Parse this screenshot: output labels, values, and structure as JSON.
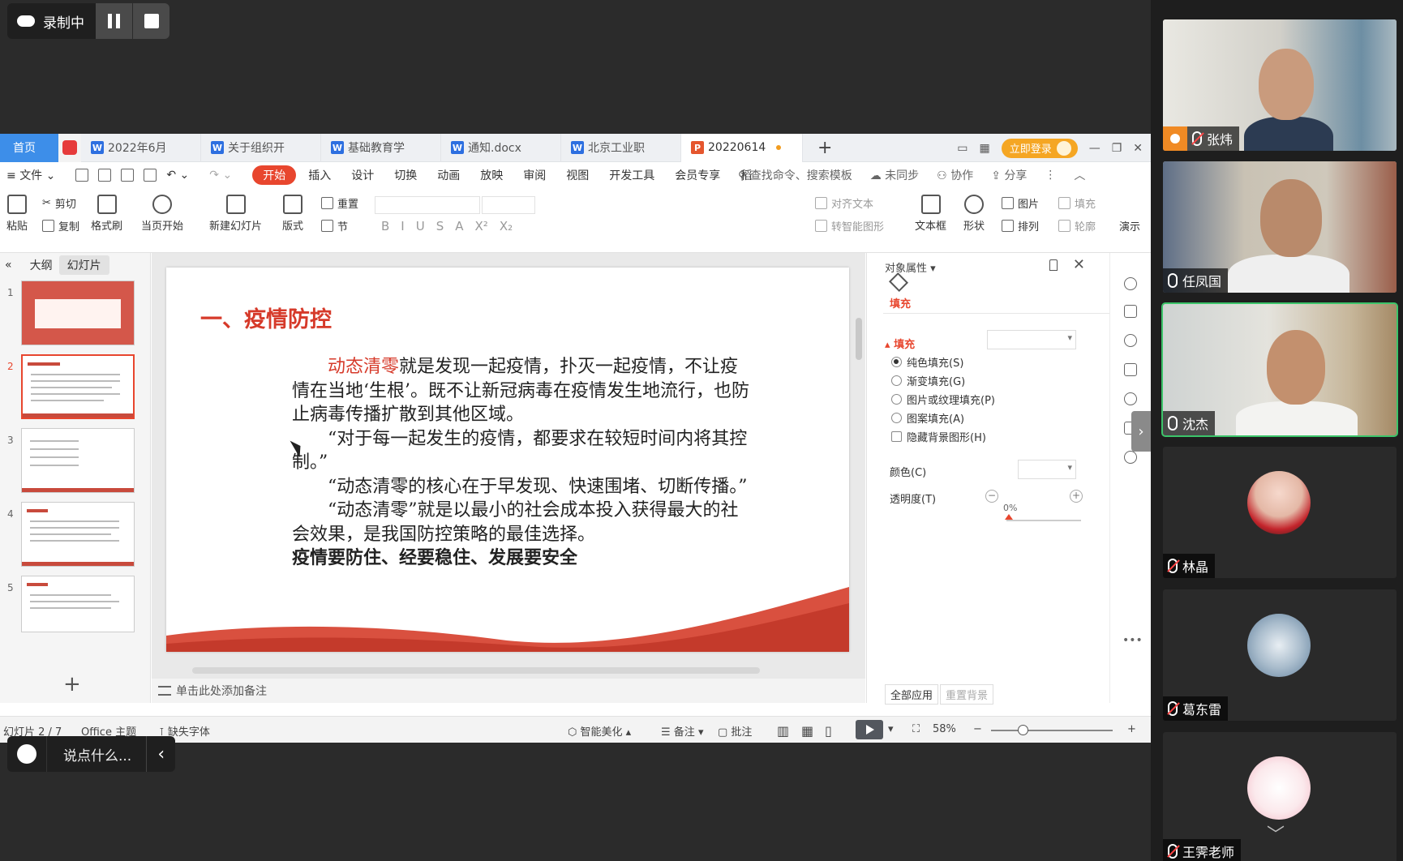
{
  "recording": {
    "label": "录制中"
  },
  "tabs": {
    "home": "首页",
    "docs": [
      {
        "label": "2022年6月",
        "type": "W"
      },
      {
        "label": "关于组织开",
        "type": "W"
      },
      {
        "label": "基础教育学",
        "type": "W"
      },
      {
        "label": "通知.docx",
        "type": "W"
      },
      {
        "label": "北京工业职",
        "type": "W"
      },
      {
        "label": "20220614",
        "type": "P"
      }
    ],
    "login": "立即登录"
  },
  "menu": {
    "file": "文件",
    "items": [
      "开始",
      "插入",
      "设计",
      "切换",
      "动画",
      "放映",
      "审阅",
      "视图",
      "开发工具",
      "会员专享",
      "稻"
    ],
    "search_placeholder": "查找命令、搜索模板",
    "sync": "未同步",
    "collab": "协作",
    "share": "分享"
  },
  "ribbon": {
    "paste": "粘贴",
    "cut": "剪切",
    "copy": "复制",
    "format_painter": "格式刷",
    "from_current": "当页开始",
    "new_slide": "新建幻灯片",
    "layout": "版式",
    "reset": "重置",
    "section": "节",
    "align_text": "对齐文本",
    "convert_smartart": "转智能图形",
    "textbox": "文本框",
    "shape": "形状",
    "picture": "图片",
    "arrange": "排列",
    "fill": "填充",
    "outline": "轮廓",
    "present": "演示"
  },
  "left_panel": {
    "tab_outline": "大纲",
    "tab_slides": "幻灯片",
    "slide_numbers": [
      "1",
      "2",
      "3",
      "4",
      "5"
    ]
  },
  "slide": {
    "title": "一、疫情防控",
    "p1_highlight": "动态清零",
    "p1_rest": "就是发现一起疫情，扑灭一起疫情，不让疫情在当地‘生根’。既不让新冠病毒在疫情发生地流行，也防止病毒传播扩散到其他区域。",
    "p2": "“对于每一起发生的疫情，都要求在较短时间内将其控制。”",
    "p3": "“动态清零的核心在于早发现、快速围堵、切断传播。”",
    "p4": "“动态清零”就是以最小的社会成本投入获得最大的社会效果，是我国防控策略的最佳选择。",
    "p5": "疫情要防住、经要稳住、发展要安全"
  },
  "notes": {
    "placeholder": "单击此处添加备注"
  },
  "props": {
    "header": "对象属性",
    "tab_fill": "填充",
    "section_fill": "填充",
    "options": [
      "纯色填充(S)",
      "渐变填充(G)",
      "图片或纹理填充(P)",
      "图案填充(A)"
    ],
    "hide_bg": "隐藏背景图形(H)",
    "color_label": "颜色(C)",
    "transparency_label": "透明度(T)",
    "transparency_value": "0%",
    "apply_all": "全部应用",
    "reset_bg": "重置背景"
  },
  "status": {
    "slide_info": "幻灯片 2 / 7",
    "theme": "Office 主题",
    "missing_font": "缺失字体",
    "beautify": "智能美化",
    "notes": "备注",
    "comments": "批注",
    "zoom": "58%"
  },
  "chat": {
    "placeholder": "说点什么..."
  },
  "participants": [
    {
      "name": "张炜",
      "mic": "off",
      "host": true,
      "video": true
    },
    {
      "name": "任凤国",
      "mic": "on",
      "host": false,
      "video": true
    },
    {
      "name": "沈杰",
      "mic": "on",
      "host": false,
      "video": true,
      "speaking": true
    },
    {
      "name": "林晶",
      "mic": "off",
      "host": false,
      "video": false
    },
    {
      "name": "葛东雷",
      "mic": "off",
      "host": false,
      "video": false
    },
    {
      "name": "王霁老师",
      "mic": "off",
      "host": false,
      "video": false
    }
  ],
  "colors": {
    "accent": "#e8462e",
    "speaking_border": "#3cc46a",
    "tab_home": "#3d8ee9"
  }
}
